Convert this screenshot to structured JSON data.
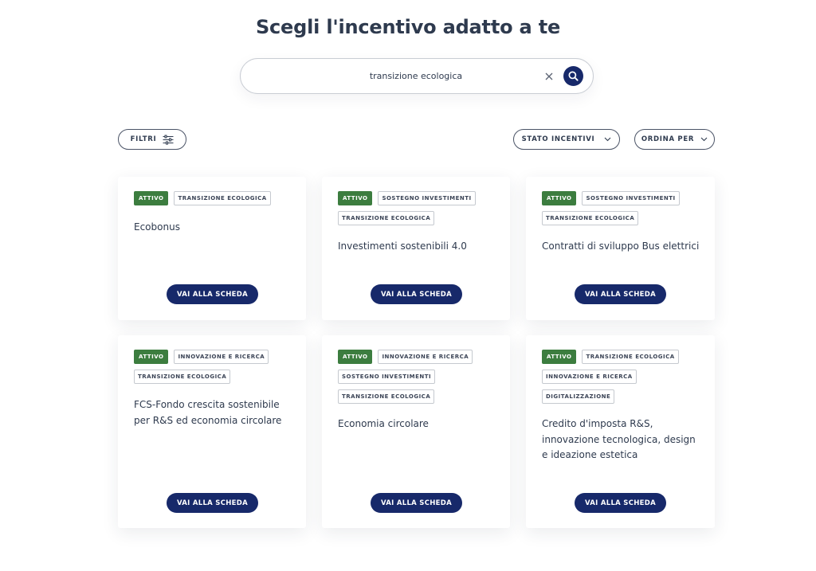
{
  "page": {
    "title": "Scegli l'incentivo adatto a te"
  },
  "search": {
    "value": "transizione ecologica",
    "clear_icon": "close-icon",
    "submit_icon": "search-icon"
  },
  "toolbar": {
    "filters_label": "FILTRI",
    "stato_label": "STATO INCENTIVI",
    "ordina_label": "ORDINA PER"
  },
  "colors": {
    "brand_navy": "#17296a",
    "active_green": "#3c7d3f"
  },
  "cards": [
    {
      "status": "ATTIVO",
      "tags": [
        "TRANSIZIONE ECOLOGICA"
      ],
      "title": "Ecobonus",
      "button": "VAI ALLA SCHEDA"
    },
    {
      "status": "ATTIVO",
      "tags": [
        "SOSTEGNO INVESTIMENTI",
        "TRANSIZIONE ECOLOGICA"
      ],
      "title": "Investimenti sostenibili 4.0",
      "button": "VAI ALLA SCHEDA"
    },
    {
      "status": "ATTIVO",
      "tags": [
        "SOSTEGNO INVESTIMENTI",
        "TRANSIZIONE ECOLOGICA"
      ],
      "title": "Contratti di sviluppo Bus elettrici",
      "button": "VAI ALLA SCHEDA"
    },
    {
      "status": "ATTIVO",
      "tags": [
        "INNOVAZIONE E RICERCA",
        "TRANSIZIONE ECOLOGICA"
      ],
      "title": "FCS-Fondo crescita sostenibile per R&S ed economia circolare",
      "button": "VAI ALLA SCHEDA"
    },
    {
      "status": "ATTIVO",
      "tags": [
        "INNOVAZIONE E RICERCA",
        "SOSTEGNO INVESTIMENTI",
        "TRANSIZIONE ECOLOGICA"
      ],
      "title": "Economia circolare",
      "button": "VAI ALLA SCHEDA"
    },
    {
      "status": "ATTIVO",
      "tags": [
        "TRANSIZIONE ECOLOGICA",
        "INNOVAZIONE E RICERCA",
        "DIGITALIZZAZIONE"
      ],
      "title": "Credito d'imposta R&S, innovazione tecnologica, design e ideazione estetica",
      "button": "VAI ALLA SCHEDA"
    }
  ]
}
